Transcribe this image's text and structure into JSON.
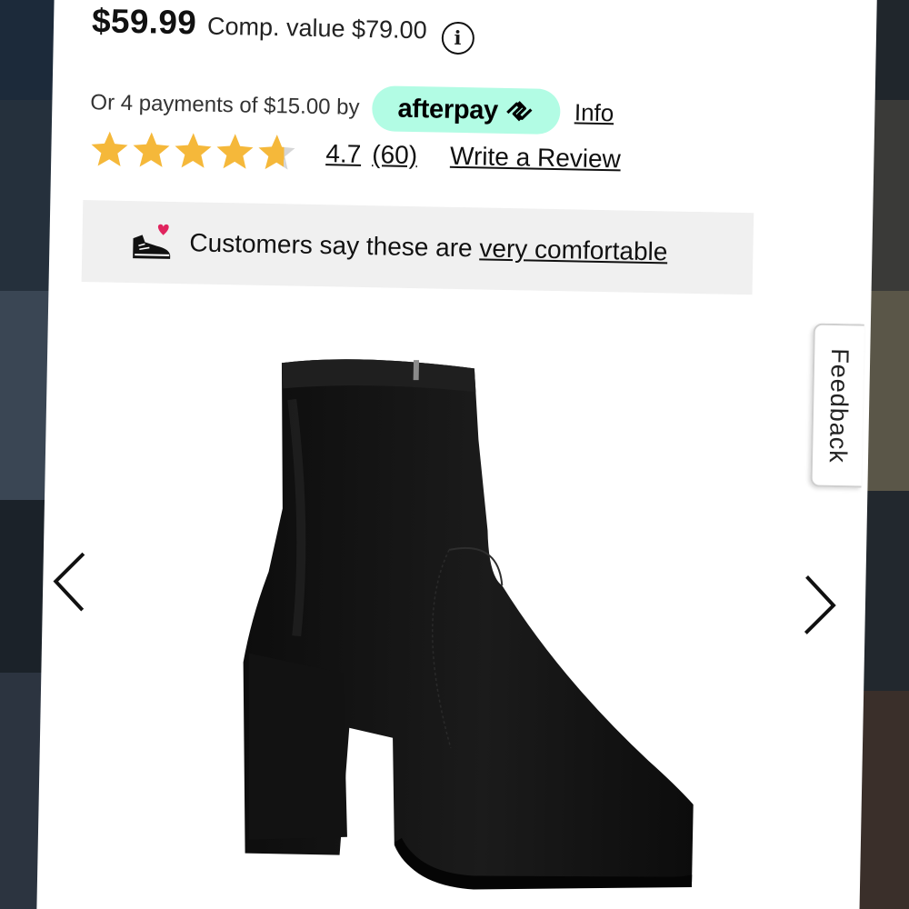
{
  "product": {
    "price": "$59.99",
    "comp_value": "Comp. value $79.00",
    "info_icon": "i"
  },
  "afterpay": {
    "installments_text": "Or 4 payments of $15.00 by",
    "brand": "afterpay",
    "info_link": "Info",
    "badge_color": "#b2fce4"
  },
  "rating": {
    "value": 4.7,
    "value_text": "4.7",
    "count_text": "(60)",
    "max_stars": 5,
    "write_review": "Write a Review",
    "star_color": "#f5b83a",
    "empty_star_color": "#d6d6d6"
  },
  "comfort_banner": {
    "icon": "shoe-heart-icon",
    "text_prefix": "Customers say these are",
    "link_text": "very comfortable"
  },
  "gallery": {
    "prev_icon": "chevron-left-icon",
    "next_icon": "chevron-right-icon",
    "image": "black-suede-ankle-boot"
  },
  "feedback": {
    "label": "Feedback"
  }
}
